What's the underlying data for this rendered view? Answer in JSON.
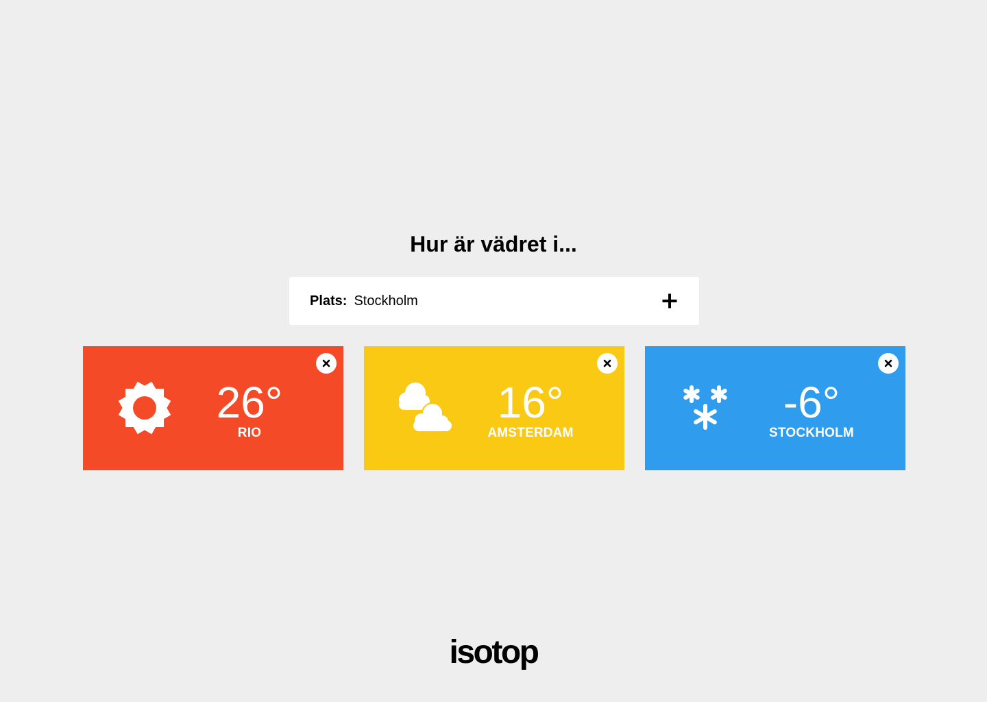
{
  "heading": "Hur är vädret i...",
  "search": {
    "label": "Plats:",
    "value": "Stockholm",
    "add_icon": "plus-icon"
  },
  "cards": [
    {
      "temperature": "26°",
      "city": "RIO",
      "icon": "sun-icon",
      "color": "#f44a27"
    },
    {
      "temperature": "16°",
      "city": "AMSTERDAM",
      "icon": "cloudy-icon",
      "color": "#f9c913"
    },
    {
      "temperature": "-6°",
      "city": "STOCKHOLM",
      "icon": "snow-icon",
      "color": "#2f9cee"
    }
  ],
  "close_icon": "close-icon",
  "logo": "isotop"
}
